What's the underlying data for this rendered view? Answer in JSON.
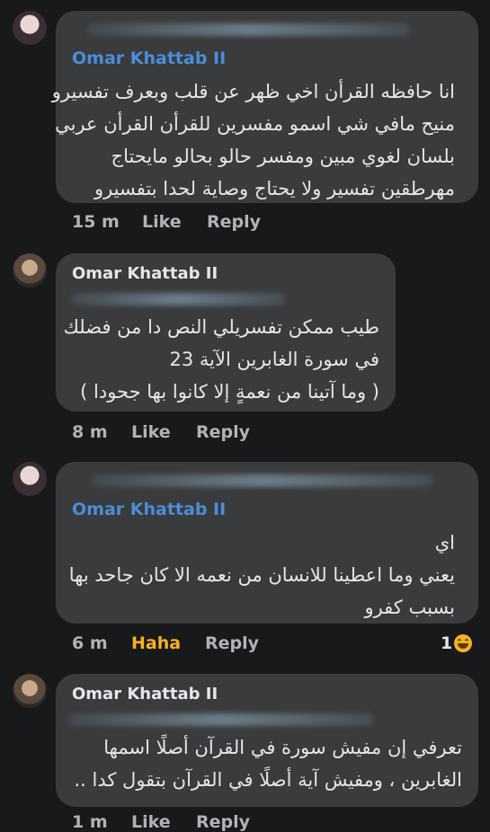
{
  "comments": [
    {
      "author": "Omar Khattab II",
      "lines": [
        "انا حافظه القرأن اخي ظهر عن قلب وبعرف تفسيرو",
        "منيح مافي شي اسمو مفسرين للقرأن القرأن عربي",
        "بلسان لغوي مبين ومفسر حالو بحالو مايحتاج",
        "مهرطقين تفسير ولا يحتاج وصاية لحدا بتفسيرو"
      ],
      "time": "15 m",
      "like": "Like",
      "reply": "Reply"
    },
    {
      "author": "Omar Khattab II",
      "lines": [
        "طيب ممكن تفسريلي النص دا من فضلك",
        "في سورة الغابرين الآية 23",
        "( وما آتينا من نعمةٍ إلا كانوا بها جحودا )"
      ],
      "time": "8 m",
      "like": "Like",
      "reply": "Reply"
    },
    {
      "author": "Omar Khattab II",
      "lines": [
        "اي",
        "يعني وما اعطينا للانسان من نعمه الا كان جاحد بها",
        "بسبب كفرو"
      ],
      "time": "6 m",
      "like": "Haha",
      "reply": "Reply",
      "reaction_count": "1"
    },
    {
      "author": "Omar Khattab II",
      "lines": [
        "تعرفي إن مفيش سورة في القرآن أصلًا اسمها",
        "الغابرين ، ومفيش آية أصلًا في القرآن بتقول كدا .."
      ],
      "time": "1 m",
      "like": "Like",
      "reply": "Reply"
    }
  ]
}
